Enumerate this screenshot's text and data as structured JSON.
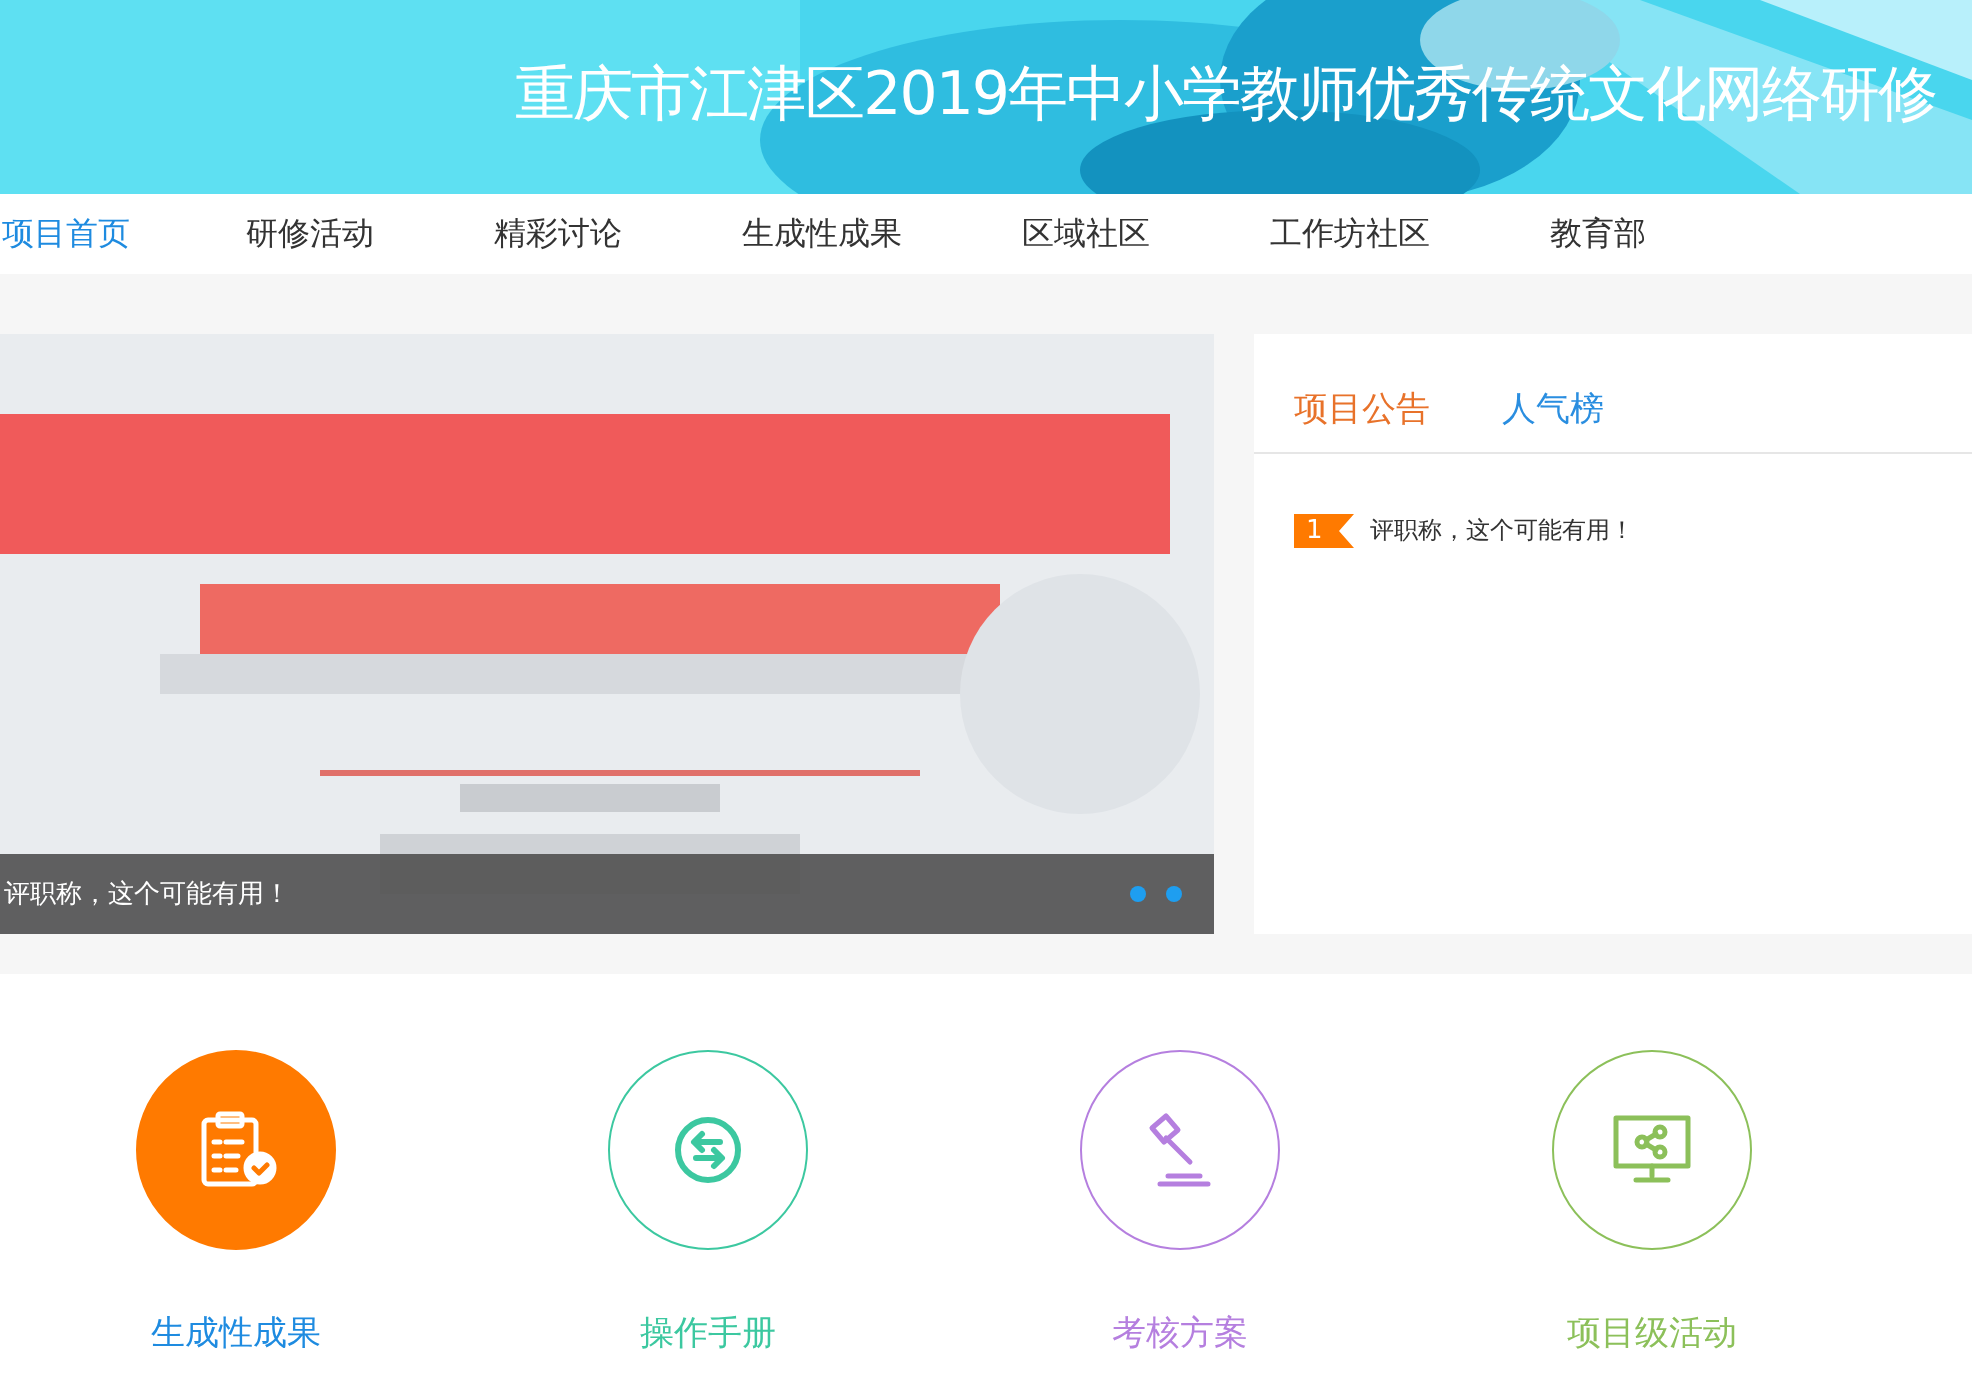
{
  "header": {
    "title": "重庆市江津区2019年中小学教师优秀传统文化网络研修"
  },
  "nav": [
    {
      "label": "项目首页",
      "selected": true
    },
    {
      "label": "研修活动",
      "selected": false
    },
    {
      "label": "精彩讨论",
      "selected": false
    },
    {
      "label": "生成性成果",
      "selected": false
    },
    {
      "label": "区域社区",
      "selected": false
    },
    {
      "label": "工作坊社区",
      "selected": false
    },
    {
      "label": "教育部",
      "selected": false
    }
  ],
  "carousel": {
    "caption": "评职称，这个可能有用！"
  },
  "notice_panel": {
    "tabs": [
      {
        "label": "项目公告",
        "selected": true
      },
      {
        "label": "人气榜",
        "selected": false
      }
    ],
    "items": [
      {
        "rank": "1",
        "title": "评职称，这个可能有用！"
      }
    ]
  },
  "quick_links": [
    {
      "label": "生成性成果",
      "kind": "clipboard",
      "color": "#ff7a00",
      "selected": true
    },
    {
      "label": "操作手册",
      "kind": "exchange",
      "color": "#3cc8a0",
      "selected": false
    },
    {
      "label": "考核方案",
      "kind": "gavel",
      "color": "#b57fdf",
      "selected": false
    },
    {
      "label": "项目级活动",
      "kind": "monitor",
      "color": "#8cc05a",
      "selected": false
    }
  ]
}
